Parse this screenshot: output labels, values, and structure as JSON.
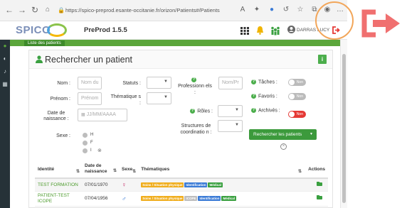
{
  "browser": {
    "url": "https://spico-preprod.esante-occitanie.fr/orizon/Patients#/Patients"
  },
  "app": {
    "logo": "SPICO",
    "env": "PreProd 1.5.5",
    "user": "DARRAS LUCY"
  },
  "breadcrumb": "Liste des patients",
  "panel": {
    "title": "Rechercher un patient",
    "info_label": "i"
  },
  "form": {
    "nom_label": "Nom :",
    "nom_placeholder": "Nom du",
    "prenom_label": "Prénom :",
    "prenom_placeholder": "Prénom",
    "dob_label": "Date de naissance :",
    "dob_placeholder": "JJ/MM/AAAA",
    "sexe_label": "Sexe :",
    "sexe_options": [
      "H",
      "F",
      "I"
    ],
    "statuts_label": "Statuts :",
    "thematique_label": "Thématique s :",
    "professionnels_label": "Professionn els :",
    "professionnels_placeholder": "Nom/Pr",
    "roles_label": "Rôles :",
    "structures_label": "Structures de coordinatio n :",
    "taches_label": "Tâches :",
    "favoris_label": "Favoris :",
    "archives_label": "Archivés :",
    "toggle_text": "Non",
    "search_button": "Rechercher les patients"
  },
  "table": {
    "headers": {
      "identite": "Identité",
      "dob": "Date de naissance",
      "sexe": "Sexe",
      "thematiques": "Thématiques",
      "actions": "Actions"
    },
    "rows": [
      {
        "identite": "TEST FORMATION",
        "dob": "07/01/1970",
        "sexe_symbol": "♀",
        "tags": [
          {
            "text": "Soins / Situation physique",
            "color": "y"
          },
          {
            "text": "Identification",
            "color": "b"
          },
          {
            "text": "Médical",
            "color": "g"
          }
        ]
      },
      {
        "identite": "PATIENT-TEST ICOPE",
        "dob": "07/04/1956",
        "sexe_symbol": "♂",
        "tags": [
          {
            "text": "Soins / Situation physique",
            "color": "y"
          },
          {
            "text": "ICOPE",
            "color": "gr"
          },
          {
            "text": "Identification",
            "color": "b"
          },
          {
            "text": "Médical",
            "color": "g"
          }
        ]
      }
    ]
  },
  "colors": {
    "brand_green": "#5ba63b",
    "logout_red": "#e53935",
    "annotation_orange": "#f2a65a"
  }
}
